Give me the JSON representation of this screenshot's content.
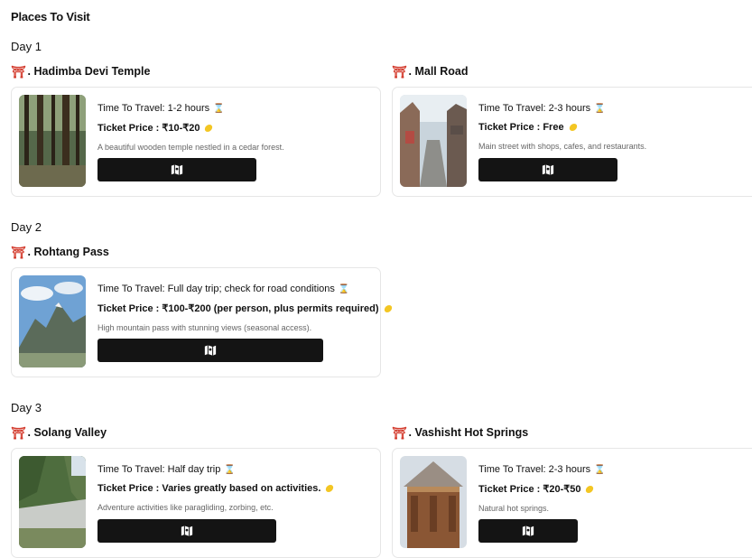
{
  "heading": "Places To Visit",
  "days": [
    {
      "label": "Day 1",
      "places": [
        {
          "name": ". Hadimba Devi Temple",
          "time": "Time To Travel: 1-2 hours",
          "price": "Ticket Price : ₹10-₹20",
          "desc": "A beautiful wooden temple nestled in a cedar forest."
        },
        {
          "name": ". Mall Road",
          "time": "Time To Travel: 2-3 hours",
          "price": "Ticket Price : Free",
          "desc": "Main street with shops, cafes, and restaurants."
        }
      ]
    },
    {
      "label": "Day 2",
      "places": [
        {
          "name": ". Rohtang Pass",
          "time": "Time To Travel: Full day trip; check for road conditions",
          "price": "Ticket Price : ₹100-₹200 (per person, plus permits required)",
          "desc": "High mountain pass with stunning views (seasonal access)."
        }
      ]
    },
    {
      "label": "Day 3",
      "places": [
        {
          "name": ". Solang Valley",
          "time": "Time To Travel: Half day trip",
          "price": "Ticket Price : Varies greatly based on activities.",
          "desc": "Adventure activities like paragliding, zorbing, etc."
        },
        {
          "name": ". Vashisht Hot Springs",
          "time": "Time To Travel: 2-3 hours",
          "price": "Ticket Price : ₹20-₹50",
          "desc": "Natural hot springs."
        }
      ]
    }
  ],
  "icons": {
    "place": "torii-gate-icon",
    "time": "hourglass-icon",
    "price": "coin-icon",
    "map": "map-icon"
  },
  "colors": {
    "accent": "#d33a2c",
    "button": "#141414",
    "coin": "#f3c623"
  }
}
